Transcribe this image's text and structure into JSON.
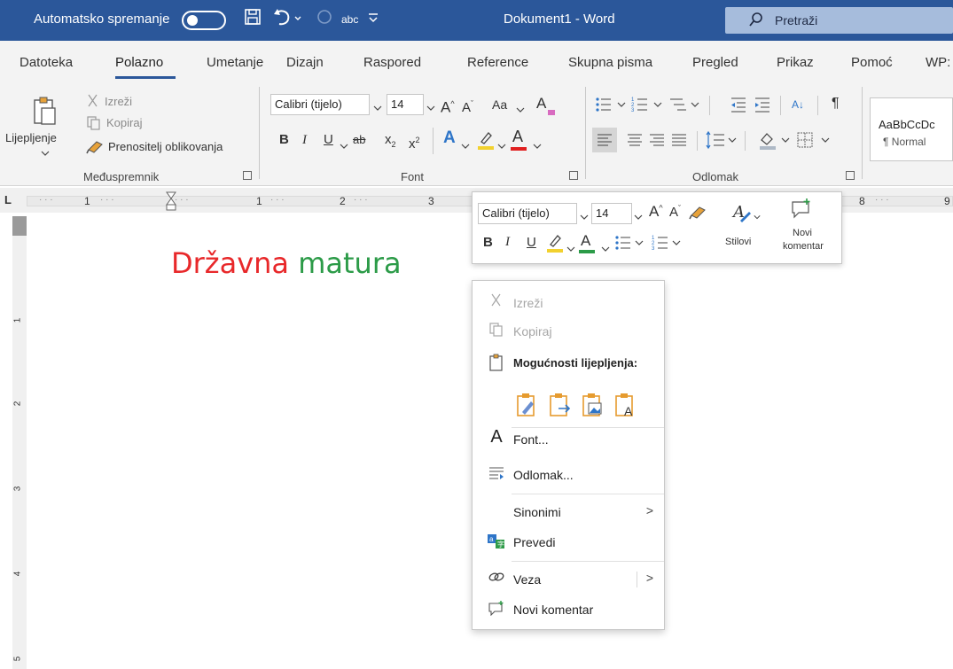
{
  "titlebar": {
    "autosave_label": "Automatsko spremanje",
    "doc_title": "Dokument1 - Word",
    "search_label": "Pretraži",
    "save_icon": "save-icon",
    "undo_icon": "undo-icon",
    "redo_icon": "redo-icon",
    "spelling_icon": "spelling-icon",
    "abc_label": "abc",
    "customize_icon": "customize-icon"
  },
  "tabs": [
    "Datoteka",
    "Polazno",
    "Umetanje",
    "Dizajn",
    "Raspored",
    "Reference",
    "Skupna pisma",
    "Pregled",
    "Prikaz",
    "Pomoć",
    "WP:"
  ],
  "ribbon": {
    "clipboard": {
      "paste_label": "Lijepljenje",
      "cut_label": "Izreži",
      "copy_label": "Kopiraj",
      "format_painter_label": "Prenositelj oblikovanja",
      "group_label": "Međuspremnik"
    },
    "font": {
      "font_name": "Calibri (tijelo)",
      "font_size": "14",
      "group_label": "Font",
      "aa_label": "Aa",
      "bold_label": "B",
      "italic_label": "I",
      "underline_label": "U",
      "strikethrough_label": "ab",
      "grow_label": "A",
      "shrink_label": "A",
      "subscript_label": "x",
      "subscript_mark": "2",
      "superscript_label": "x",
      "superscript_mark": "2",
      "text_effects_label": "A",
      "font_color_label": "A",
      "clear_label": "A",
      "highlight_color": "#f2d12e",
      "font_color": "#e02020"
    },
    "paragraph": {
      "group_label": "Odlomak",
      "sort_label": "A↓",
      "pilcrow": "¶"
    },
    "styles": {
      "preview": "AaBbCcDc",
      "name": "¶ Normal"
    }
  },
  "ruler": {
    "marker": "L",
    "numbers": [
      "1",
      "1",
      "2",
      "3",
      "8",
      "9"
    ],
    "vertical_numbers": [
      "1",
      "2",
      "3",
      "4",
      "5"
    ]
  },
  "document": {
    "word1": "Državna",
    "word2": "matura",
    "word1_color": "#e8282a",
    "word2_color": "#2c9b48"
  },
  "mini_toolbar": {
    "font_name": "Calibri (tijelo)",
    "font_size": "14",
    "bold_label": "B",
    "italic_label": "I",
    "underline_label": "U",
    "font_color_label": "A",
    "grow_label": "A",
    "shrink_label": "A",
    "styles_label": "Stilovi",
    "styles_glyph": "A",
    "new_comment_label_1": "Novi",
    "new_comment_label_2": "komentar"
  },
  "context_menu": {
    "cut": "Izreži",
    "copy": "Kopiraj",
    "paste_options": "Mogućnosti lijepljenja:",
    "font": "Font...",
    "font_glyph": "A",
    "paragraph": "Odlomak...",
    "synonyms": "Sinonimi",
    "translate": "Prevedi",
    "link": "Veza",
    "new_comment": "Novi komentar",
    "submenu_arrow": ">"
  }
}
